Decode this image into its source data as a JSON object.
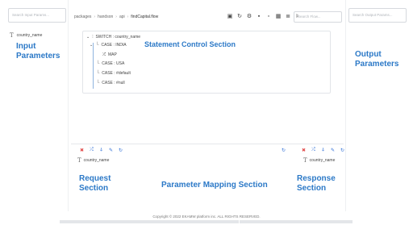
{
  "input_panel": {
    "search_placeholder": "Search Input Params...",
    "param_name": "country_name",
    "overlay": "Input\nParameters"
  },
  "output_panel": {
    "search_placeholder": "Search Output Params...",
    "overlay": "Output\nParameters"
  },
  "breadcrumb": [
    "packages",
    "handson",
    "api",
    "findCapital.flow"
  ],
  "flow_search_placeholder": "Search Flow...",
  "tree": {
    "switch_label": "SWITCH : country_name",
    "cases": [
      {
        "label": "CASE : INDIA"
      },
      {
        "label": "MAP"
      },
      {
        "label": "CASE : USA"
      },
      {
        "label": "CASE : #default"
      },
      {
        "label": "CASE : #null"
      }
    ],
    "overlay": "Statement Control Section"
  },
  "request": {
    "param_name": "country_name",
    "overlay": "Request\nSection"
  },
  "response": {
    "param_name": "country_name",
    "overlay": "Response\nSection"
  },
  "mapping_overlay": "Parameter Mapping Section",
  "footer": "Copyright © 2022 EKAMW platform inc. ALL RIGHTS RESERVED."
}
